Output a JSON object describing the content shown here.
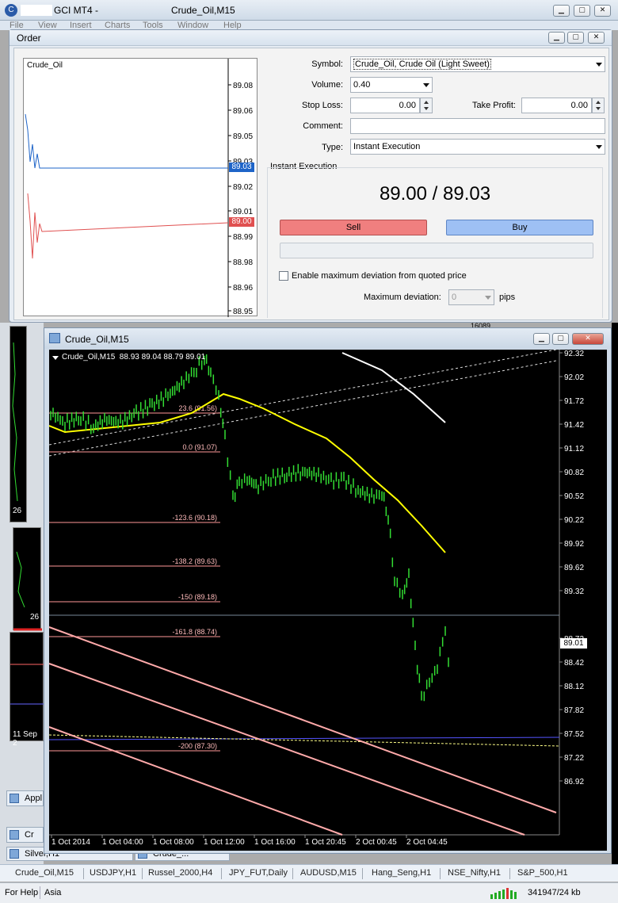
{
  "main_window": {
    "title_prefix": "GCI MT4 -",
    "title_chart": "Crude_Oil,M15",
    "menu": [
      "File",
      "View",
      "Insert",
      "Charts",
      "Tools",
      "Window",
      "Help"
    ]
  },
  "order": {
    "title": "Order",
    "mini_chart": {
      "label": "Crude_Oil",
      "price_labels": [
        "89.08",
        "89.06",
        "89.05",
        "89.03",
        "89.02",
        "89.01",
        "88.99",
        "88.98",
        "88.96",
        "88.95"
      ],
      "ask_tag": "89.03",
      "bid_tag": "89.00"
    },
    "symbol_label": "Symbol:",
    "symbol_value": "Crude_Oil, Crude Oil (Light Sweet)",
    "volume_label": "Volume:",
    "volume_value": "0.40",
    "stop_loss_label": "Stop Loss:",
    "stop_loss_value": "0.00",
    "take_profit_label": "Take Profit:",
    "take_profit_value": "0.00",
    "comment_label": "Comment:",
    "comment_value": "",
    "type_label": "Type:",
    "type_value": "Instant Execution",
    "group_label": "Instant Execution",
    "quote": "89.00 / 89.03",
    "sell_label": "Sell",
    "buy_label": "Buy",
    "deviation_checkbox_label": "Enable maximum deviation from quoted price",
    "max_deviation_label": "Maximum deviation:",
    "max_deviation_value": "0",
    "pips_label": "pips"
  },
  "chart": {
    "window_title": "Crude_Oil,M15",
    "header": "Crude_Oil,M15  88.93 89.04 88.79 89.01",
    "current_price_tag": "89.01",
    "price_axis": [
      "92.32",
      "92.02",
      "91.72",
      "91.42",
      "91.12",
      "90.82",
      "90.52",
      "90.22",
      "89.92",
      "89.62",
      "89.32",
      "88.72",
      "88.42",
      "88.12",
      "87.82",
      "87.52",
      "87.22",
      "86.92"
    ],
    "time_axis": [
      "1 Oct 2014",
      "1 Oct 04:00",
      "1 Oct 08:00",
      "1 Oct 12:00",
      "1 Oct 16:00",
      "1 Oct 20:45",
      "2 Oct 00:45",
      "2 Oct 04:45"
    ],
    "fib_levels": [
      "23.6 (91.56)",
      "0.0 (91.07)",
      "-123.6 (90.18)",
      "-138.2 (89.63)",
      "-150 (89.18)",
      "-161.8 (88.74)",
      "-200 (87.30)"
    ],
    "background_left_labels": [
      "26",
      "26",
      "11 Sep 2"
    ],
    "background_right_label": "16089"
  },
  "background_tabs": {
    "app_tab": "Appl",
    "cr_tab": "Cr",
    "silver_tab": "Silver,H1",
    "crude_tab": "Crude_..."
  },
  "bottom_tabs": [
    "Crude_Oil,M15",
    "USDJPY,H1",
    "Russel_2000,H4",
    "JPY_FUT,Daily",
    "AUDUSD,M15",
    "Hang_Seng,H1",
    "NSE_Nifty,H1",
    "S&P_500,H1"
  ],
  "status": {
    "help": "For Help",
    "profile": "Asia",
    "traffic": "341947/24 kb"
  },
  "colors": {
    "sell": "#f07f7f",
    "buy": "#9ec0f4",
    "ask_line": "#1e64c8",
    "bid_line": "#e05050",
    "chart_bg": "#000000",
    "candles": "#33dd33",
    "ma_yellow": "#ffff00",
    "fib_line": "#ff9999"
  }
}
